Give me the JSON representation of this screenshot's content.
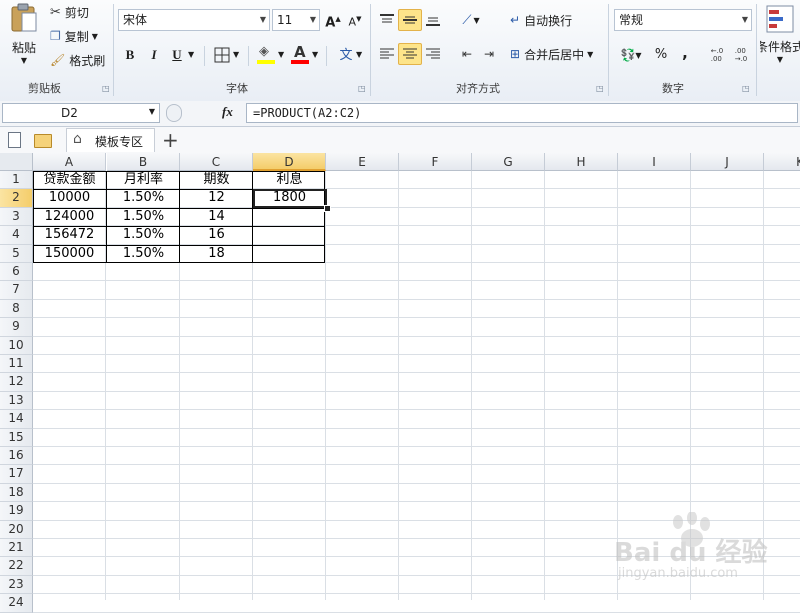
{
  "ribbon": {
    "clipboard": {
      "paste_label": "粘贴",
      "cut_label": "剪切",
      "copy_label": "复制",
      "format_painter_label": "格式刷",
      "group_label": "剪贴板"
    },
    "font": {
      "font_name": "宋体",
      "font_size": "11",
      "bold": "B",
      "italic": "I",
      "underline": "U",
      "font_color_glyph": "A",
      "group_label": "字体"
    },
    "alignment": {
      "wrap_text_label": "自动换行",
      "merge_center_label": "合并后居中",
      "group_label": "对齐方式"
    },
    "number": {
      "format_value": "常规",
      "percent": "%",
      "comma": ",",
      "inc_decimal": "+.0 .00",
      "dec_decimal": ".00 +.0",
      "group_label": "数字"
    },
    "styles": {
      "conditional_format_label": "条件格式"
    },
    "colors": {
      "highlight": "#fde48a",
      "fill_color_bar": "#ffff00",
      "font_color_bar": "#ff0000"
    }
  },
  "formula_bar": {
    "name_box": "D2",
    "fx_label": "fx",
    "formula": "=PRODUCT(A2:C2)"
  },
  "tabs": {
    "home_tab": "模板专区",
    "add_tab": "+"
  },
  "sheet": {
    "columns": [
      "A",
      "B",
      "C",
      "D",
      "E",
      "F",
      "G",
      "H",
      "I",
      "J",
      "K"
    ],
    "rows": [
      "1",
      "2",
      "3",
      "4",
      "5",
      "6",
      "7",
      "8",
      "9",
      "10",
      "11",
      "12",
      "13",
      "14",
      "15",
      "16",
      "17",
      "18",
      "19",
      "20",
      "21",
      "22",
      "23",
      "24"
    ],
    "selected_cell": "D2",
    "table": [
      [
        "贷款金额",
        "月利率",
        "期数",
        "利息"
      ],
      [
        "10000",
        "1.50%",
        "12",
        "1800"
      ],
      [
        "124000",
        "1.50%",
        "14",
        ""
      ],
      [
        "156472",
        "1.50%",
        "16",
        ""
      ],
      [
        "150000",
        "1.50%",
        "18",
        ""
      ]
    ]
  },
  "watermark": {
    "brand": "Bai du 经验",
    "url": "jingyan.baidu.com"
  }
}
